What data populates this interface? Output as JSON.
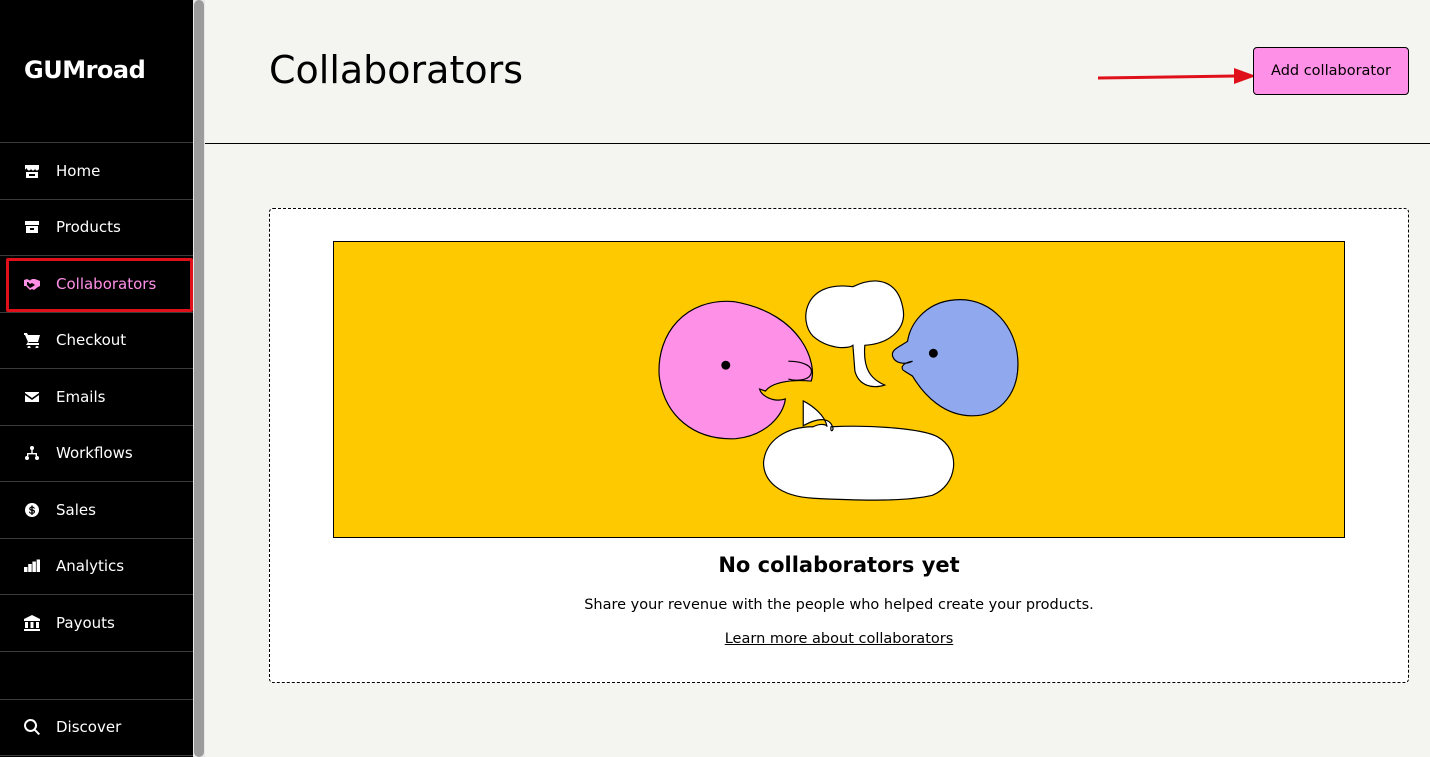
{
  "sidebar": {
    "logo": "GUMroad",
    "items": [
      {
        "label": "Home",
        "icon": "store-icon"
      },
      {
        "label": "Products",
        "icon": "archive-icon"
      },
      {
        "label": "Collaborators",
        "icon": "handshake-icon"
      },
      {
        "label": "Checkout",
        "icon": "cart-icon"
      },
      {
        "label": "Emails",
        "icon": "envelope-icon"
      },
      {
        "label": "Workflows",
        "icon": "workflow-icon"
      },
      {
        "label": "Sales",
        "icon": "dollar-circle-icon"
      },
      {
        "label": "Analytics",
        "icon": "bar-chart-icon"
      },
      {
        "label": "Payouts",
        "icon": "bank-icon"
      }
    ],
    "bottom_items": [
      {
        "label": "Discover",
        "icon": "search-icon"
      }
    ],
    "active_index": 2
  },
  "header": {
    "title": "Collaborators",
    "add_button_label": "Add collaborator"
  },
  "empty_state": {
    "title": "No collaborators yet",
    "description": "Share your revenue with the people who helped create your products.",
    "link_label": "Learn more about collaborators"
  },
  "colors": {
    "accent_pink": "#ff90e8",
    "illustration_bg": "#ffc900",
    "blue_face": "#90a8ed",
    "annotation_red": "#e0101a"
  }
}
